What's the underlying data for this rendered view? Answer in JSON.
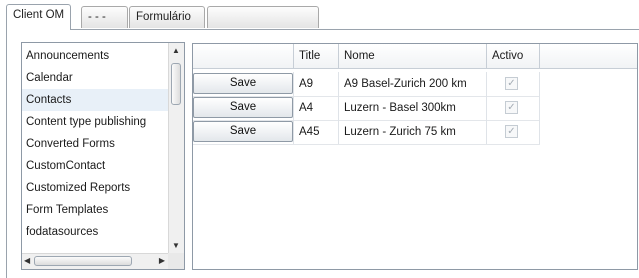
{
  "tabs": [
    {
      "label": "Client OM",
      "active": true
    },
    {
      "label": "- - -",
      "active": false
    },
    {
      "label": "Formulário",
      "active": false
    },
    {
      "label": "",
      "active": false,
      "blurred": true
    }
  ],
  "list": {
    "items": [
      "Announcements",
      "Calendar",
      "Contacts",
      "Content type publishing",
      "Converted Forms",
      "CustomContact",
      "Customized Reports",
      "Form Templates",
      "fodatasources"
    ],
    "selected_index": 2,
    "scroll_up_icon": "▲",
    "scroll_down_icon": "▼",
    "scroll_left_icon": "◀",
    "scroll_right_icon": "▶"
  },
  "grid": {
    "columns": [
      "",
      "Title",
      "Nome",
      "Activo"
    ],
    "rows": [
      {
        "button": "Save",
        "title": "A9",
        "nome": "A9 Basel-Zurich 200 km",
        "activo": true
      },
      {
        "button": "Save",
        "title": "A4",
        "nome": "Luzern - Basel 300km",
        "activo": true
      },
      {
        "button": "Save",
        "title": "A45",
        "nome": "Luzern - Zurich 75 km",
        "activo": true
      }
    ],
    "check_glyph": "✓"
  }
}
